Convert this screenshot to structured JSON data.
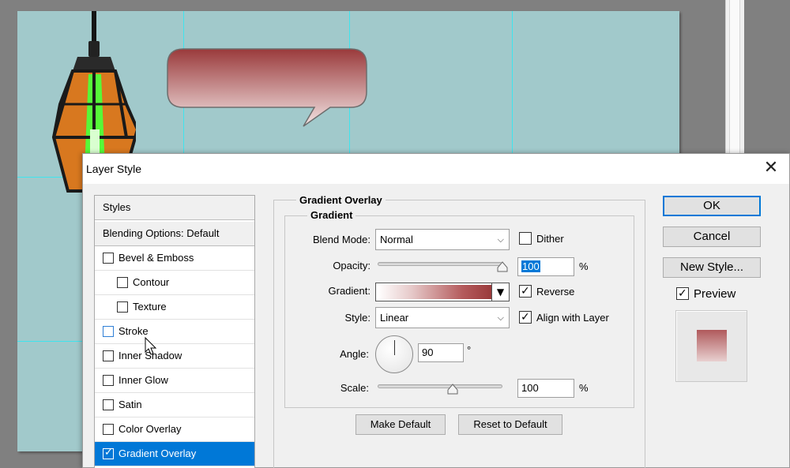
{
  "dialog": {
    "title": "Layer Style",
    "close_glyph": "✕"
  },
  "styles_list": {
    "header": "Styles",
    "blending": "Blending Options: Default",
    "items": [
      {
        "label": "Bevel & Emboss",
        "checked": false
      },
      {
        "label": "Contour",
        "checked": false
      },
      {
        "label": "Texture",
        "checked": false
      },
      {
        "label": "Stroke",
        "checked": false
      },
      {
        "label": "Inner Shadow",
        "checked": false
      },
      {
        "label": "Inner Glow",
        "checked": false
      },
      {
        "label": "Satin",
        "checked": false
      },
      {
        "label": "Color Overlay",
        "checked": false
      },
      {
        "label": "Gradient Overlay",
        "checked": true,
        "selected": true
      }
    ]
  },
  "gradient_overlay": {
    "section_title": "Gradient Overlay",
    "group_title": "Gradient",
    "blend_mode_label": "Blend Mode:",
    "blend_mode_value": "Normal",
    "dither_label": "Dither",
    "dither_checked": false,
    "opacity_label": "Opacity:",
    "opacity_value": "100",
    "opacity_unit": "%",
    "opacity_fraction": 1.0,
    "gradient_label": "Gradient:",
    "gradient_colors": [
      "#ffffff",
      "#e6c9c9",
      "#b45a5c",
      "#9a3a3b"
    ],
    "reverse_label": "Reverse",
    "reverse_checked": true,
    "style_label": "Style:",
    "style_value": "Linear",
    "align_label": "Align with Layer",
    "align_checked": true,
    "angle_label": "Angle:",
    "angle_value": "90",
    "angle_unit": "°",
    "scale_label": "Scale:",
    "scale_value": "100",
    "scale_unit": "%",
    "scale_fraction": 0.6,
    "make_default_label": "Make Default",
    "reset_default_label": "Reset to Default"
  },
  "actions": {
    "ok_label": "OK",
    "cancel_label": "Cancel",
    "new_style_label": "New Style...",
    "preview_label": "Preview",
    "preview_checked": true
  },
  "colors": {
    "canvas_bg": "#a1c9cb",
    "guide": "#3fe4ee",
    "selection": "#0078d7",
    "bubble_top": "#9a3a3b",
    "bubble_bottom": "#f3e4e4",
    "lamp_glow": "#4fff3a",
    "lamp_amber": "#d8781f"
  },
  "icons": {
    "close": "close-icon",
    "chevron": "chevron-down-icon",
    "check": "check-icon",
    "cursor": "arrow-cursor-icon"
  }
}
